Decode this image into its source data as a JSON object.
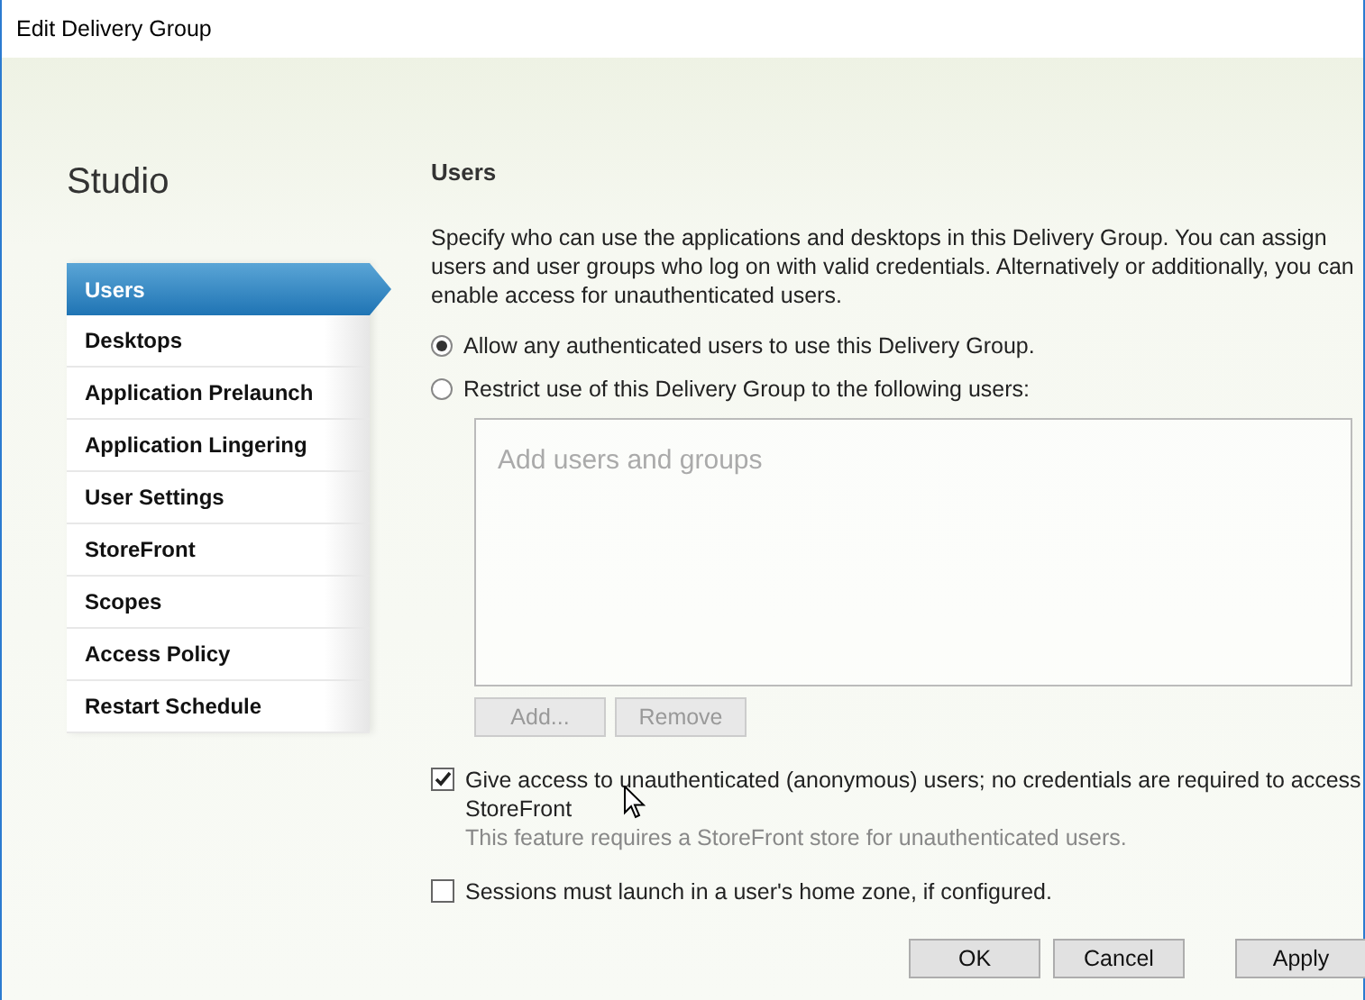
{
  "window": {
    "title": "Edit Delivery Group"
  },
  "sidebar": {
    "heading": "Studio",
    "items": [
      {
        "label": "Users",
        "selected": true
      },
      {
        "label": "Desktops",
        "selected": false
      },
      {
        "label": "Application Prelaunch",
        "selected": false
      },
      {
        "label": "Application Lingering",
        "selected": false
      },
      {
        "label": "User Settings",
        "selected": false
      },
      {
        "label": "StoreFront",
        "selected": false
      },
      {
        "label": "Scopes",
        "selected": false
      },
      {
        "label": "Access Policy",
        "selected": false
      },
      {
        "label": "Restart Schedule",
        "selected": false
      }
    ]
  },
  "content": {
    "heading": "Users",
    "description": "Specify who can use the applications and desktops in this Delivery Group. You can assign users and user groups who log on with valid credentials. Alternatively or additionally, you can enable access for unauthenticated users.",
    "radios": [
      {
        "label": "Allow any authenticated users to use this Delivery Group.",
        "selected": true
      },
      {
        "label": "Restrict use of this Delivery Group to the following users:",
        "selected": false
      }
    ],
    "users_box": {
      "placeholder": "Add users and groups"
    },
    "list_buttons": [
      {
        "label": "Add...",
        "disabled": true
      },
      {
        "label": "Remove",
        "disabled": true
      }
    ],
    "options": [
      {
        "label": "Give access to unauthenticated (anonymous) users; no credentials are required to access StoreFront",
        "checked": true,
        "note": "This feature requires a StoreFront store for unauthenticated users."
      },
      {
        "label": "Sessions must launch in a user's home zone, if configured.",
        "checked": false
      }
    ]
  },
  "buttons": [
    "OK",
    "Cancel",
    "Apply"
  ]
}
